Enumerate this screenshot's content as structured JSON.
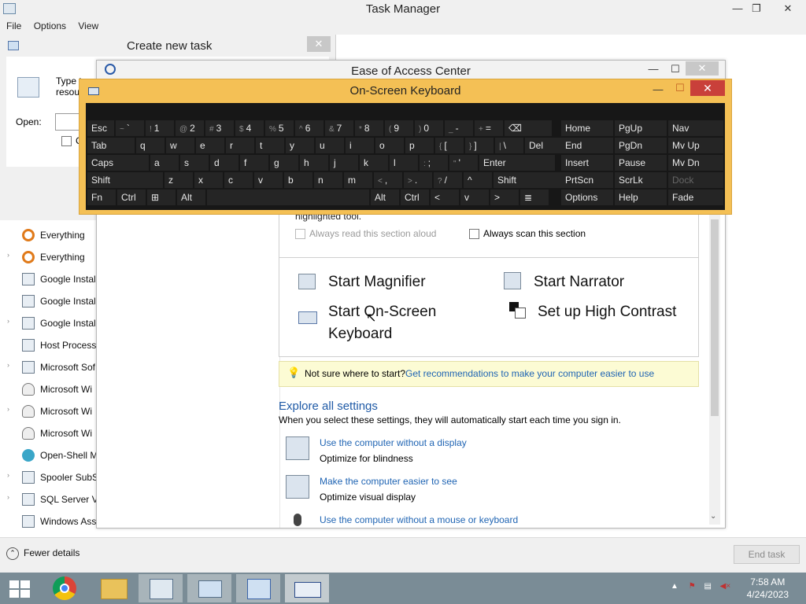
{
  "task_manager": {
    "title": "Task Manager",
    "menu": [
      "File",
      "Options",
      "View"
    ],
    "processes": [
      {
        "label": "Everything",
        "icon": "magnifier-icon",
        "expand": false
      },
      {
        "label": "Everything",
        "icon": "magnifier-icon",
        "expand": true
      },
      {
        "label": "Google Install",
        "icon": "installer-icon",
        "expand": false
      },
      {
        "label": "Google Install",
        "icon": "installer-icon",
        "expand": false
      },
      {
        "label": "Google Install",
        "icon": "installer-icon",
        "expand": true
      },
      {
        "label": "Host Process",
        "icon": "window-icon",
        "expand": false
      },
      {
        "label": "Microsoft Sof",
        "icon": "window-icon",
        "expand": true
      },
      {
        "label": "Microsoft Wi",
        "icon": "user-icon",
        "expand": false
      },
      {
        "label": "Microsoft Wi",
        "icon": "user-icon",
        "expand": true
      },
      {
        "label": "Microsoft Wi",
        "icon": "user-icon",
        "expand": false
      },
      {
        "label": "Open-Shell M",
        "icon": "shell-icon",
        "expand": false
      },
      {
        "label": "Spooler SubSy",
        "icon": "printer-icon",
        "expand": true
      },
      {
        "label": "SQL Server VS",
        "icon": "window-icon",
        "expand": true
      },
      {
        "label": "Windows Ass",
        "icon": "window-icon",
        "expand": false
      }
    ],
    "fewer_details": "Fewer details",
    "end_task": "End task"
  },
  "create_task": {
    "title": "Create new task",
    "type_text": "Type t",
    "resource_text": "resou",
    "open_label": "Open:",
    "checkbox_text": "C"
  },
  "ease_of_access": {
    "title": "Ease of Access Center",
    "highlighted": "highlighted tool.",
    "always_read": "Always read this section aloud",
    "always_scan": "Always scan this section",
    "start_magnifier": "Start Magnifier",
    "start_narrator": "Start Narrator",
    "start_osk_line1": "Start On-Screen",
    "start_osk_line2": "Keyboard",
    "high_contrast": "Set up High Contrast",
    "tip_text": "Not sure where to start?",
    "tip_link": "Get recommendations to make your computer easier to use",
    "explore_heading": "Explore all settings",
    "explore_desc": "When you select these settings, they will automatically start each time you sign in.",
    "settings": [
      {
        "link": "Use the computer without a display",
        "desc": "Optimize for blindness"
      },
      {
        "link": "Make the computer easier to see",
        "desc": "Optimize visual display"
      },
      {
        "link": "Use the computer without a mouse or keyboard",
        "desc": ""
      }
    ]
  },
  "osk": {
    "title": "On-Screen Keyboard",
    "rows": [
      [
        [
          "Esc",
          ""
        ],
        [
          "`",
          "~"
        ],
        [
          "1",
          "!"
        ],
        [
          "2",
          "@"
        ],
        [
          "3",
          "#"
        ],
        [
          "4",
          "$"
        ],
        [
          "5",
          "%"
        ],
        [
          "6",
          "^"
        ],
        [
          "7",
          "&"
        ],
        [
          "8",
          "*"
        ],
        [
          "9",
          "("
        ],
        [
          "0",
          ")"
        ],
        [
          "-",
          "_"
        ],
        [
          "=",
          "+"
        ],
        [
          "⌫",
          ""
        ]
      ],
      [
        [
          "Tab",
          ""
        ],
        [
          "q",
          ""
        ],
        [
          "w",
          ""
        ],
        [
          "e",
          ""
        ],
        [
          "r",
          ""
        ],
        [
          "t",
          ""
        ],
        [
          "y",
          ""
        ],
        [
          "u",
          ""
        ],
        [
          "i",
          ""
        ],
        [
          "o",
          ""
        ],
        [
          "p",
          ""
        ],
        [
          "[",
          "{"
        ],
        [
          "]",
          "}"
        ],
        [
          "\\",
          "|"
        ],
        [
          "Del",
          ""
        ]
      ],
      [
        [
          "Caps",
          ""
        ],
        [
          "a",
          ""
        ],
        [
          "s",
          ""
        ],
        [
          "d",
          ""
        ],
        [
          "f",
          ""
        ],
        [
          "g",
          ""
        ],
        [
          "h",
          ""
        ],
        [
          "j",
          ""
        ],
        [
          "k",
          ""
        ],
        [
          "l",
          ""
        ],
        [
          ";",
          ":"
        ],
        [
          "'",
          "\""
        ],
        [
          "Enter",
          ""
        ]
      ],
      [
        [
          "Shift",
          ""
        ],
        [
          "z",
          ""
        ],
        [
          "x",
          ""
        ],
        [
          "c",
          ""
        ],
        [
          "v",
          ""
        ],
        [
          "b",
          ""
        ],
        [
          "n",
          ""
        ],
        [
          "m",
          ""
        ],
        [
          ",",
          "<"
        ],
        [
          ".",
          ">"
        ],
        [
          "/",
          "?"
        ],
        [
          "^",
          ""
        ],
        [
          "Shift",
          ""
        ]
      ],
      [
        [
          "Fn",
          ""
        ],
        [
          "Ctrl",
          ""
        ],
        [
          "⊞",
          ""
        ],
        [
          "Alt",
          ""
        ],
        [
          "",
          ""
        ],
        [
          "Alt",
          ""
        ],
        [
          "Ctrl",
          ""
        ],
        [
          "<",
          ""
        ],
        [
          "v",
          ""
        ],
        [
          ">",
          ""
        ],
        [
          "≣",
          ""
        ]
      ]
    ],
    "side": [
      [
        "Home",
        "PgUp",
        "Nav"
      ],
      [
        "End",
        "PgDn",
        "Mv Up"
      ],
      [
        "Insert",
        "Pause",
        "Mv Dn"
      ],
      [
        "PrtScn",
        "ScrLk",
        "Dock"
      ],
      [
        "Options",
        "Help",
        "Fade"
      ]
    ]
  },
  "taskbar": {
    "time": "7:58 AM",
    "date": "4/24/2023"
  }
}
